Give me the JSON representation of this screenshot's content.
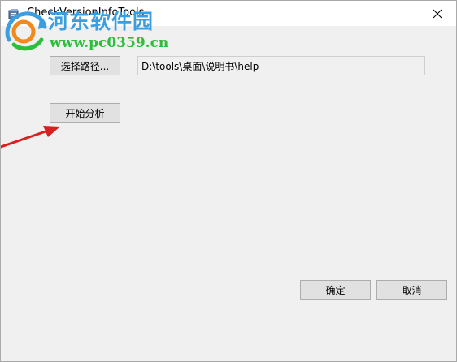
{
  "window": {
    "title": "CheckVersionInfoTools",
    "close_glyph": "✕"
  },
  "watermark": {
    "site_name": "河东软件园",
    "url": "www.pc0359.cn",
    "name_color": "#3a9ee0",
    "url_color": "#2bbf3a"
  },
  "form": {
    "select_path_label": "选择路径...",
    "path_value": "D:\\tools\\桌面\\说明书\\help",
    "analyze_label": "开始分析"
  },
  "footer": {
    "ok_label": "确定",
    "cancel_label": "取消"
  },
  "annotation": {
    "arrow_color": "#d9201f",
    "arrow_icon": "red-arrow-icon"
  }
}
